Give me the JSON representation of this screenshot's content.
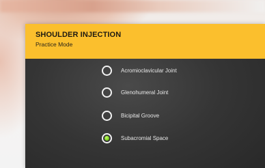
{
  "header": {
    "title": "SHOULDER INJECTION",
    "subtitle": "Practice Mode"
  },
  "options": [
    {
      "label": "Acromioclavicular Joint",
      "selected": false
    },
    {
      "label": "Glenohumeral Joint",
      "selected": false
    },
    {
      "label": "Bicipital Groove",
      "selected": false
    },
    {
      "label": "Subacromial Space",
      "selected": true
    }
  ],
  "colors": {
    "header_bg": "#fbbf2d",
    "panel_bg": "#2e2e2e",
    "radio_selected": "#7ad31a"
  }
}
